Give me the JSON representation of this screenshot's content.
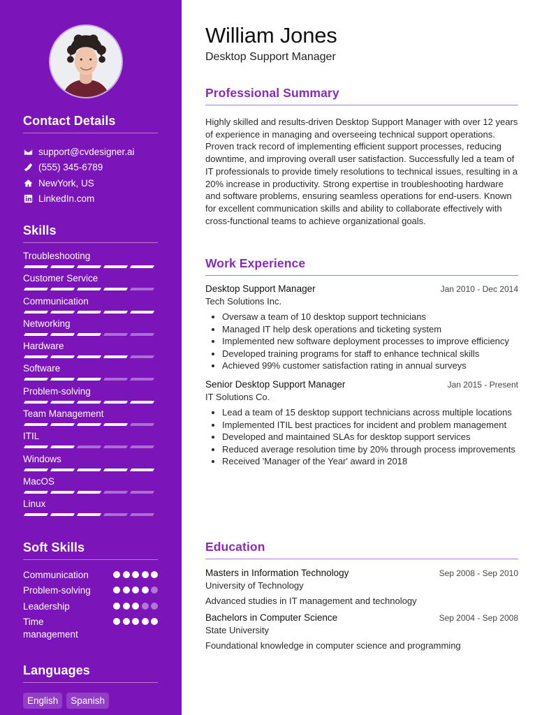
{
  "profile": {
    "name": "William Jones",
    "headline": "Desktop Support Manager",
    "avatar_alt": "Profile photo"
  },
  "colors": {
    "sidebar": "#7b14b9",
    "accent": "#8a2bbf"
  },
  "contact": {
    "title": "Contact Details",
    "items": [
      {
        "icon": "envelope-icon",
        "text": "support@cvdesigner.ai"
      },
      {
        "icon": "phone-icon",
        "text": "(555) 345-6789"
      },
      {
        "icon": "home-icon",
        "text": "NewYork, US"
      },
      {
        "icon": "linkedin-icon",
        "text": "LinkedIn.com"
      }
    ]
  },
  "skills": {
    "title": "Skills",
    "max_level": 5,
    "items": [
      {
        "name": "Troubleshooting",
        "level": 5
      },
      {
        "name": "Customer Service",
        "level": 4
      },
      {
        "name": "Communication",
        "level": 5
      },
      {
        "name": "Networking",
        "level": 3
      },
      {
        "name": "Hardware",
        "level": 4
      },
      {
        "name": "Software",
        "level": 3
      },
      {
        "name": "Problem-solving",
        "level": 5
      },
      {
        "name": "Team Management",
        "level": 4
      },
      {
        "name": "ITIL",
        "level": 2
      },
      {
        "name": "Windows",
        "level": 5
      },
      {
        "name": "MacOS",
        "level": 3
      },
      {
        "name": "Linux",
        "level": 3
      }
    ]
  },
  "soft_skills": {
    "title": "Soft Skills",
    "max_level": 5,
    "items": [
      {
        "name": "Communication",
        "level": 5
      },
      {
        "name": "Problem-solving",
        "level": 4
      },
      {
        "name": "Leadership",
        "level": 3
      },
      {
        "name": "Time management",
        "level": 5
      }
    ]
  },
  "languages": {
    "title": "Languages",
    "items": [
      "English",
      "Spanish"
    ]
  },
  "summary": {
    "title": "Professional Summary",
    "text": "Highly skilled and results-driven Desktop Support Manager with over 12 years of experience in managing and overseeing technical support operations. Proven track record of implementing efficient support processes, reducing downtime, and improving overall user satisfaction. Successfully led a team of IT professionals to provide timely resolutions to technical issues, resulting in a 20% increase in productivity. Strong expertise in troubleshooting hardware and software problems, ensuring seamless operations for end-users. Known for excellent communication skills and ability to collaborate effectively with cross-functional teams to achieve organizational goals."
  },
  "experience": {
    "title": "Work Experience",
    "jobs": [
      {
        "title": "Desktop Support Manager",
        "company": "Tech Solutions Inc.",
        "dates": "Jan 2010 - Dec 2014",
        "bullets": [
          "Oversaw a team of 10 desktop support technicians",
          "Managed IT help desk operations and ticketing system",
          "Implemented new software deployment processes to improve efficiency",
          "Developed training programs for staff to enhance technical skills",
          "Achieved 99% customer satisfaction rating in annual surveys"
        ]
      },
      {
        "title": "Senior Desktop Support Manager",
        "company": "IT Solutions Co.",
        "dates": "Jan 2015 - Present",
        "bullets": [
          "Lead a team of 15 desktop support technicians across multiple locations",
          "Implemented ITIL best practices for incident and problem management",
          "Developed and maintained SLAs for desktop support services",
          "Reduced average resolution time by 20% through process improvements",
          "Received 'Manager of the Year' award in 2018"
        ]
      }
    ]
  },
  "education": {
    "title": "Education",
    "items": [
      {
        "degree": "Masters in Information Technology",
        "school": "University of Technology",
        "dates": "Sep 2008 - Sep 2010",
        "description": "Advanced studies in IT management and technology"
      },
      {
        "degree": "Bachelors in Computer Science",
        "school": "State University",
        "dates": "Sep 2004 - Sep 2008",
        "description": "Foundational knowledge in computer science and programming"
      }
    ]
  }
}
